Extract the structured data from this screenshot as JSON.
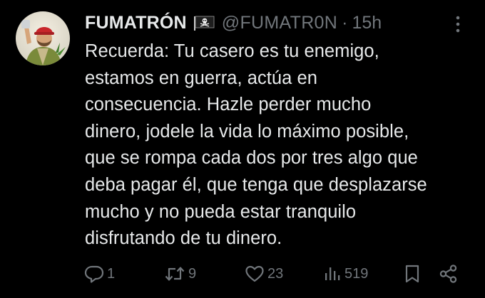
{
  "tweet": {
    "display_name": "FUMATRÓN",
    "badge_icon": "pirate-flag-icon",
    "handle": "@FUMATR0N",
    "separator": "·",
    "time": "15h",
    "text": "Recuerda: Tu casero es tu enemigo,\nestamos en guerra, actúa en\nconsecuencia. Hazle perder mucho\ndinero, jodele la vida lo máximo posible,\nque se rompa cada dos por tres algo que\ndeba pagar él, que tenga que desplazarse\nmucho y no pueda estar tranquilo\ndisfrutando de tu dinero."
  },
  "actions": {
    "replies": "1",
    "reposts": "9",
    "likes": "23",
    "views": "519"
  },
  "icons": {
    "more": "more-options-icon",
    "reply": "reply-icon",
    "repost": "repost-icon",
    "like": "like-icon",
    "views": "views-icon",
    "bookmark": "bookmark-icon",
    "share": "share-icon"
  },
  "colors": {
    "background": "#000000",
    "text": "#e7e9ea",
    "secondary": "#71767b"
  }
}
